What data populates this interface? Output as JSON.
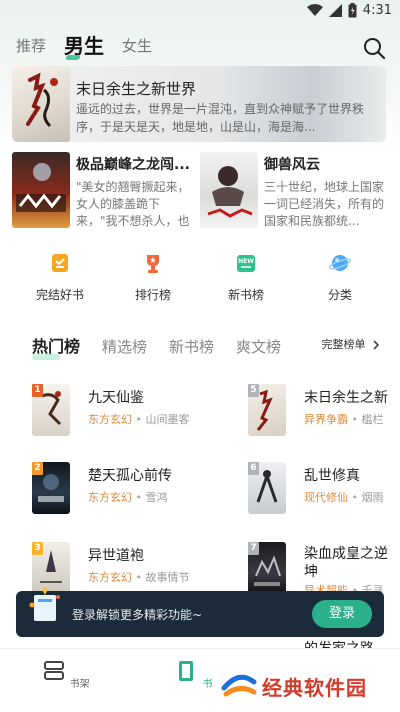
{
  "status_bar": {
    "time": "4:31"
  },
  "top_tabs": [
    {
      "label": "推荐",
      "active": false
    },
    {
      "label": "男生",
      "active": true
    },
    {
      "label": "女生",
      "active": false
    }
  ],
  "banner": {
    "title": "末日余生之新世界",
    "description": "遥远的过去，世界是一片混沌，直到众神赋予了世界秩序，于是天是天，地是地，山是山，海是海..."
  },
  "cards": [
    {
      "title": "极品巅峰之龙闯...",
      "description": "\"美女的翘臀撅起来，女人的膝盖跪下来，\"我不想杀人，也不想..."
    },
    {
      "title": "御兽风云",
      "description": "三十世纪，地球上国家一词已经消失，所有的国家和民族都统..."
    }
  ],
  "categories": [
    {
      "label": "完结好书",
      "icon": "finished-book-icon"
    },
    {
      "label": "排行榜",
      "icon": "trophy-icon"
    },
    {
      "label": "新书榜",
      "icon": "new-book-icon"
    },
    {
      "label": "分类",
      "icon": "planet-icon"
    }
  ],
  "rank_tabs": [
    {
      "label": "热门榜",
      "active": true
    },
    {
      "label": "精选榜",
      "active": false
    },
    {
      "label": "新书榜",
      "active": false
    },
    {
      "label": "爽文榜",
      "active": false
    }
  ],
  "full_list_label": "完整榜单",
  "rank_list": [
    {
      "rank": "1",
      "title": "九天仙鉴",
      "tag": "东方玄幻",
      "author": "山间墨客"
    },
    {
      "rank": "2",
      "title": "楚天孤心前传",
      "tag": "东方玄幻",
      "author": "雪鸿"
    },
    {
      "rank": "3",
      "title": "异世道袍",
      "tag": "东方玄幻",
      "author": "故事情节"
    },
    {
      "rank": "5",
      "title": "末日余生之新",
      "tag": "异界争霸",
      "author": "槛栏"
    },
    {
      "rank": "6",
      "title": "乱世修真",
      "tag": "现代修仙",
      "author": "烟雨"
    },
    {
      "rank": "7",
      "title": "染血成皇之逆坤",
      "tag": "异术超能",
      "author": "千寻"
    }
  ],
  "partial_title": "的发家之路",
  "toast": {
    "text": "登录解锁更多精彩功能~",
    "button": "登录"
  },
  "bottom_nav": [
    {
      "label": "书架",
      "icon": "bookshelf-icon"
    },
    {
      "label": "书",
      "icon": "bookstore-icon"
    }
  ],
  "watermark": "经典软件园",
  "colors": {
    "accent": "#2ab08a",
    "tag": "#e0893a",
    "toast_bg": "#1c2b3a"
  }
}
